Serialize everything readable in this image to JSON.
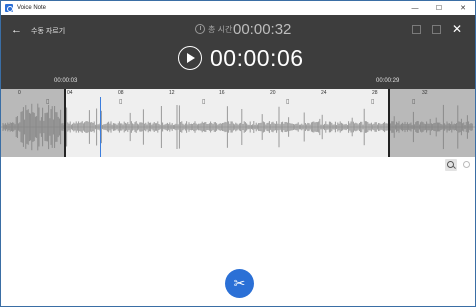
{
  "window": {
    "title": "Voice Note",
    "minimize": "—",
    "maximize": "☐",
    "close": "✕"
  },
  "header": {
    "back_icon": "←",
    "title": "수동 자르기",
    "total_label": "총 시간",
    "total_time": "00:00:32",
    "current_time": "00:00:06",
    "close_icon": "✕"
  },
  "trim": {
    "start_label": "00:00:03",
    "end_label": "00:00:29"
  },
  "ruler": {
    "ticks": [
      {
        "label": "0"
      },
      {
        "label": "04"
      },
      {
        "label": "08"
      },
      {
        "label": "12"
      },
      {
        "label": "16"
      },
      {
        "label": "20"
      },
      {
        "label": "24"
      },
      {
        "label": "28"
      },
      {
        "label": "32"
      }
    ]
  },
  "cut_button": {
    "icon": "✂"
  },
  "colors": {
    "header_bg": "#3d3d3d",
    "accent": "#2b70d6",
    "cursor": "#3b7ddd",
    "wave": "#9a9a9a"
  }
}
